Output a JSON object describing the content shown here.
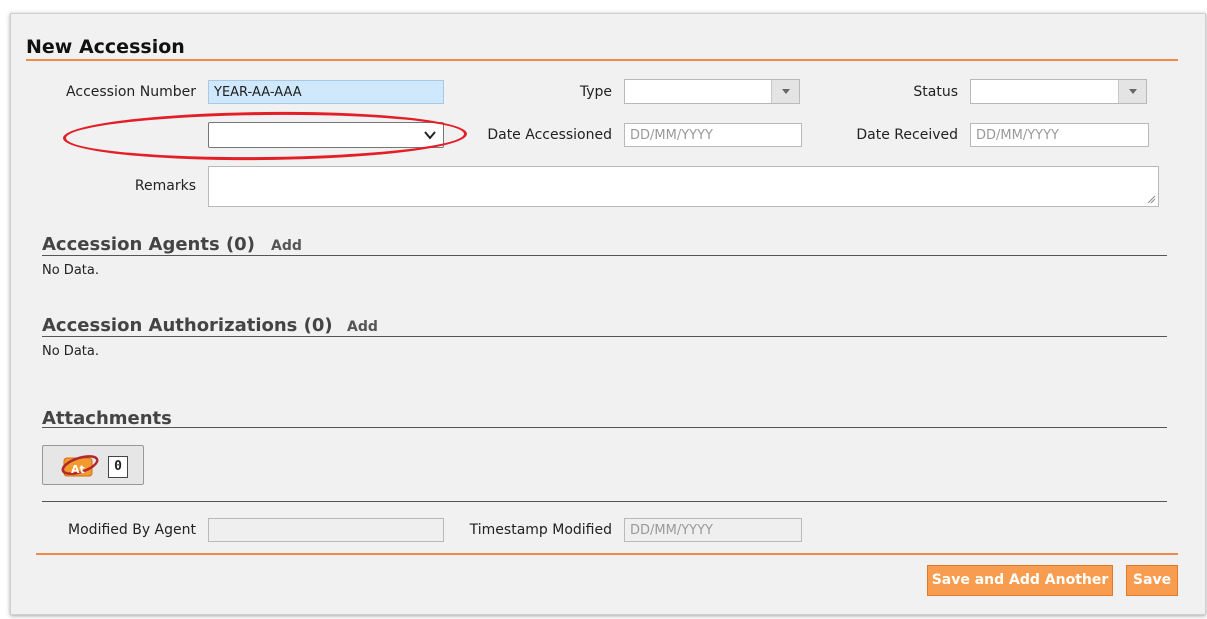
{
  "form": {
    "title": "New Accession",
    "accession_number_label": "Accession Number",
    "accession_number_value": "YEAR-AA-AAA",
    "type_label": "Type",
    "type_value": "",
    "status_label": "Status",
    "status_value": "",
    "unlabeled_select_value": "",
    "date_accessioned_label": "Date Accessioned",
    "date_accessioned_placeholder": "DD/MM/YYYY",
    "date_received_label": "Date Received",
    "date_received_placeholder": "DD/MM/YYYY",
    "remarks_label": "Remarks",
    "remarks_value": ""
  },
  "agents": {
    "heading": "Accession Agents (0)",
    "add_label": "Add",
    "empty_text": "No Data."
  },
  "authorizations": {
    "heading": "Accession Authorizations (0)",
    "add_label": "Add",
    "empty_text": "No Data."
  },
  "attachments": {
    "heading": "Attachments",
    "icon": "attachment-icon",
    "count": "0"
  },
  "audit": {
    "modified_by_label": "Modified By Agent",
    "modified_by_value": "",
    "timestamp_label": "Timestamp Modified",
    "timestamp_placeholder": "DD/MM/YYYY"
  },
  "actions": {
    "save_add_another_label": "Save and Add Another",
    "save_label": "Save"
  },
  "colors": {
    "accent_orange": "#f08a4b",
    "button_orange": "#f89d4f",
    "highlight_red": "#e41e26",
    "accession_field_bg": "#cfe8fc"
  }
}
